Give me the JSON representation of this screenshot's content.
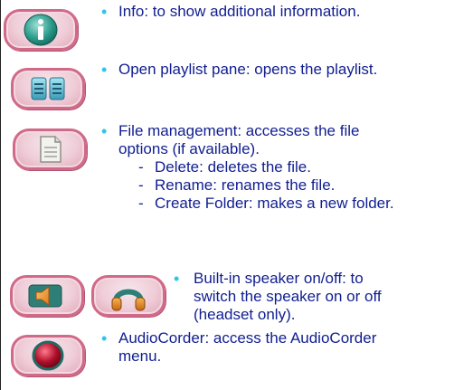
{
  "items": [
    {
      "bullet": "•",
      "text_lines": [
        "Info: to show additional information."
      ],
      "icon": "info-icon"
    },
    {
      "bullet": "•",
      "text_lines": [
        "Open playlist pane: opens the playlist."
      ],
      "icon": "playlist-icon"
    },
    {
      "bullet": "•",
      "text_lines": [
        "File management: accesses the file",
        "options (if available)."
      ],
      "sub_items": [
        {
          "dash": "-",
          "text": "Delete: deletes the file."
        },
        {
          "dash": "-",
          "text": "Rename: renames the file."
        },
        {
          "dash": "-",
          "text": "Create Folder: makes a new folder."
        }
      ],
      "icon": "file-icon"
    },
    {
      "bullet": "•",
      "text_lines": [
        "Built-in speaker on/off: to",
        "switch the speaker on or off",
        "(headset only)."
      ],
      "icons": [
        "speaker-icon",
        "headset-icon"
      ]
    },
    {
      "bullet": "•",
      "text_lines": [
        "AudioCorder: access the AudioCorder",
        "menu."
      ],
      "icon": "record-icon"
    }
  ],
  "colors": {
    "text": "#101e90",
    "bullet": "#2ec6e8",
    "button_border": "#d06a88",
    "button_fill": "#efcdd8"
  }
}
